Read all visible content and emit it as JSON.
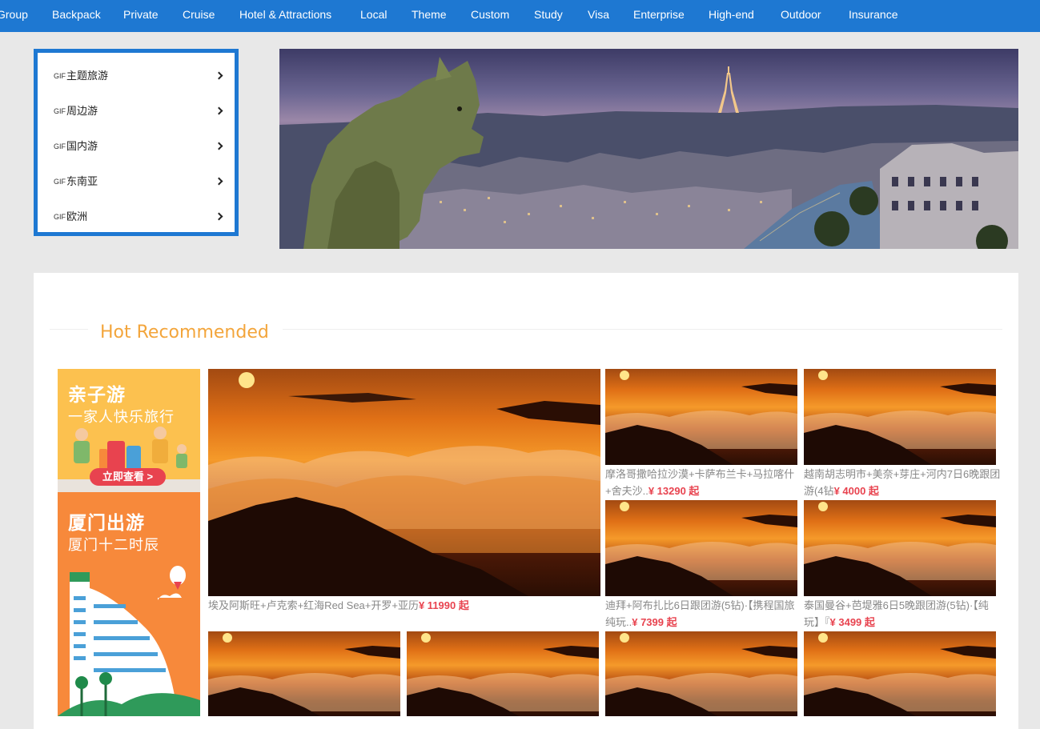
{
  "nav": {
    "items": [
      "Group",
      "Backpack",
      "Private",
      "Cruise",
      "Hotel & Attractions",
      "Local",
      "Theme",
      "Custom",
      "Study",
      "Visa",
      "Enterprise",
      "High-end",
      "Outdoor",
      "Insurance"
    ]
  },
  "categories": {
    "gif_label": "GIF",
    "items": [
      "主题旅游",
      "周边游",
      "国内游",
      "东南亚",
      "欧洲"
    ]
  },
  "section": {
    "title": "Hot Recommended"
  },
  "promos": [
    {
      "title": "亲子游",
      "subtitle": "一家人快乐旅行",
      "button": "立即查看 >"
    },
    {
      "title": "厦门出游",
      "subtitle": "厦门十二时辰"
    }
  ],
  "products": [
    {
      "name": "埃及阿斯旺+卢克索+红海Red Sea+开罗+亚历",
      "price": "¥ 11990 起"
    },
    {
      "name": "摩洛哥撒哈拉沙漠+卡萨布兰卡+马拉喀什+舍夫沙..",
      "price": "¥ 13290 起"
    },
    {
      "name": "越南胡志明市+美奈+芽庄+河内7日6晚跟团游(4钻",
      "price": "¥ 4000 起"
    },
    {
      "name": "迪拜+阿布扎比6日跟团游(5钻)·【携程国旅纯玩..",
      "price": "¥ 7399 起"
    },
    {
      "name": "泰国曼谷+芭堤雅6日5晚跟团游(5钻)·【纯玩】『",
      "price": "¥ 3499 起"
    }
  ],
  "colors": {
    "nav_bg": "#1e78d2",
    "accent": "#f3a53b",
    "price": "#e8434f"
  }
}
